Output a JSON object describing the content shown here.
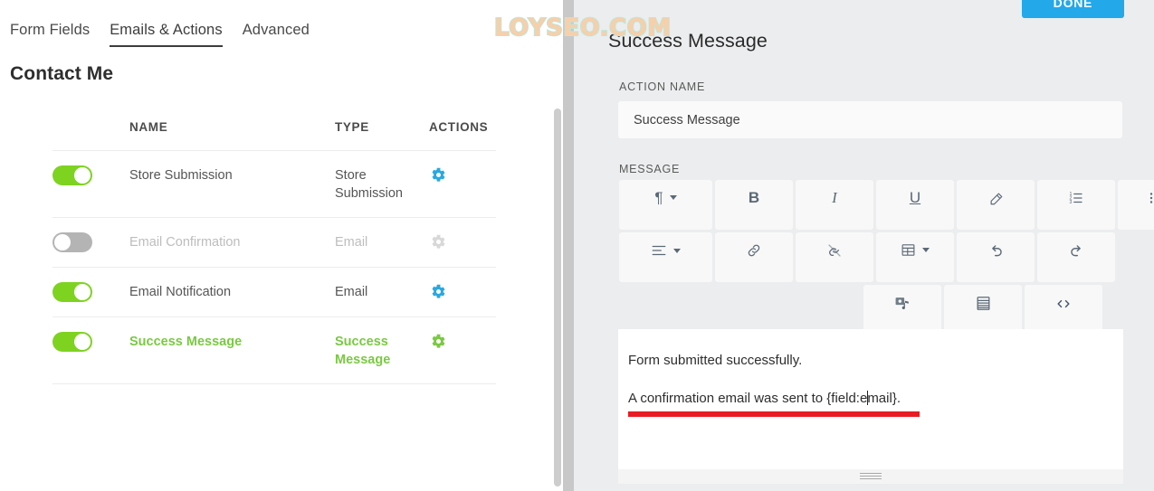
{
  "watermark": "LOYSEO.COM",
  "left": {
    "tabs": [
      {
        "label": "Form Fields",
        "active": false
      },
      {
        "label": "Emails & Actions",
        "active": true
      },
      {
        "label": "Advanced",
        "active": false
      }
    ],
    "form_title": "Contact Me",
    "table": {
      "headers": {
        "toggle": "",
        "name": "NAME",
        "type": "TYPE",
        "actions": "ACTIONS"
      },
      "rows": [
        {
          "enabled": true,
          "name": "Store Submission",
          "type": "Store Submission",
          "gear_color": "#29a8e0",
          "state": "normal"
        },
        {
          "enabled": false,
          "name": "Email Confirmation",
          "type": "Email",
          "gear_color": "#d8d8d8",
          "state": "disabled"
        },
        {
          "enabled": true,
          "name": "Email Notification",
          "type": "Email",
          "gear_color": "#29a8e0",
          "state": "normal"
        },
        {
          "enabled": true,
          "name": "Success Message",
          "type": "Success Message",
          "gear_color": "#7ac943",
          "state": "selected"
        }
      ]
    }
  },
  "right": {
    "done_label": "DONE",
    "panel_title": "Success Message",
    "action_name_label": "ACTION NAME",
    "action_name_value": "Success Message",
    "action_name_placeholder": "Action Name",
    "message_label": "MESSAGE",
    "toolbar": {
      "row1": [
        {
          "name": "paragraph-format-button",
          "glyph": "¶",
          "caret": true,
          "size": "wide"
        },
        {
          "name": "bold-button",
          "glyph": "B",
          "caret": false,
          "size": "mid"
        },
        {
          "name": "italic-button",
          "glyph": "I",
          "caret": false,
          "size": "mid"
        },
        {
          "name": "underline-button",
          "glyph": "U̲",
          "caret": false,
          "size": "mid"
        },
        {
          "name": "clear-formatting-button",
          "glyph": "▱",
          "caret": false,
          "size": "mid"
        },
        {
          "name": "ordered-list-button",
          "glyph": "≣",
          "caret": false,
          "size": "mid"
        },
        {
          "name": "unordered-list-button",
          "glyph": "≣",
          "caret": false,
          "size": "mid"
        }
      ],
      "row2": [
        {
          "name": "align-button",
          "glyph": "≡",
          "caret": true,
          "size": "wide"
        },
        {
          "name": "insert-link-button",
          "glyph": "ὑ7",
          "caret": false,
          "size": "mid"
        },
        {
          "name": "unlink-button",
          "glyph": "✂",
          "caret": false,
          "size": "mid"
        },
        {
          "name": "insert-table-button",
          "glyph": "⊞",
          "caret": true,
          "size": "mid"
        },
        {
          "name": "undo-button",
          "glyph": "↶",
          "caret": false,
          "size": "mid"
        },
        {
          "name": "redo-button",
          "glyph": "↷",
          "caret": false,
          "size": "mid"
        }
      ],
      "row3": [
        {
          "name": "insert-media-button",
          "glyph": "⚇",
          "caret": false,
          "size": "mid"
        },
        {
          "name": "insert-widget-button",
          "glyph": "▤",
          "caret": false,
          "size": "mid"
        },
        {
          "name": "code-view-button",
          "glyph": "‹›",
          "caret": false,
          "size": "mid"
        }
      ]
    },
    "editor": {
      "line1": "Form submitted successfully.",
      "line2_before": "A confirmation email was sent to {field:e",
      "line2_after": "mail}.",
      "underline_color": "#e81c22"
    }
  },
  "colors": {
    "accent_blue": "#23a8ea",
    "accent_green": "#7ed321",
    "panel_bg": "#ebedee",
    "gutter": "#c8c8c8"
  }
}
